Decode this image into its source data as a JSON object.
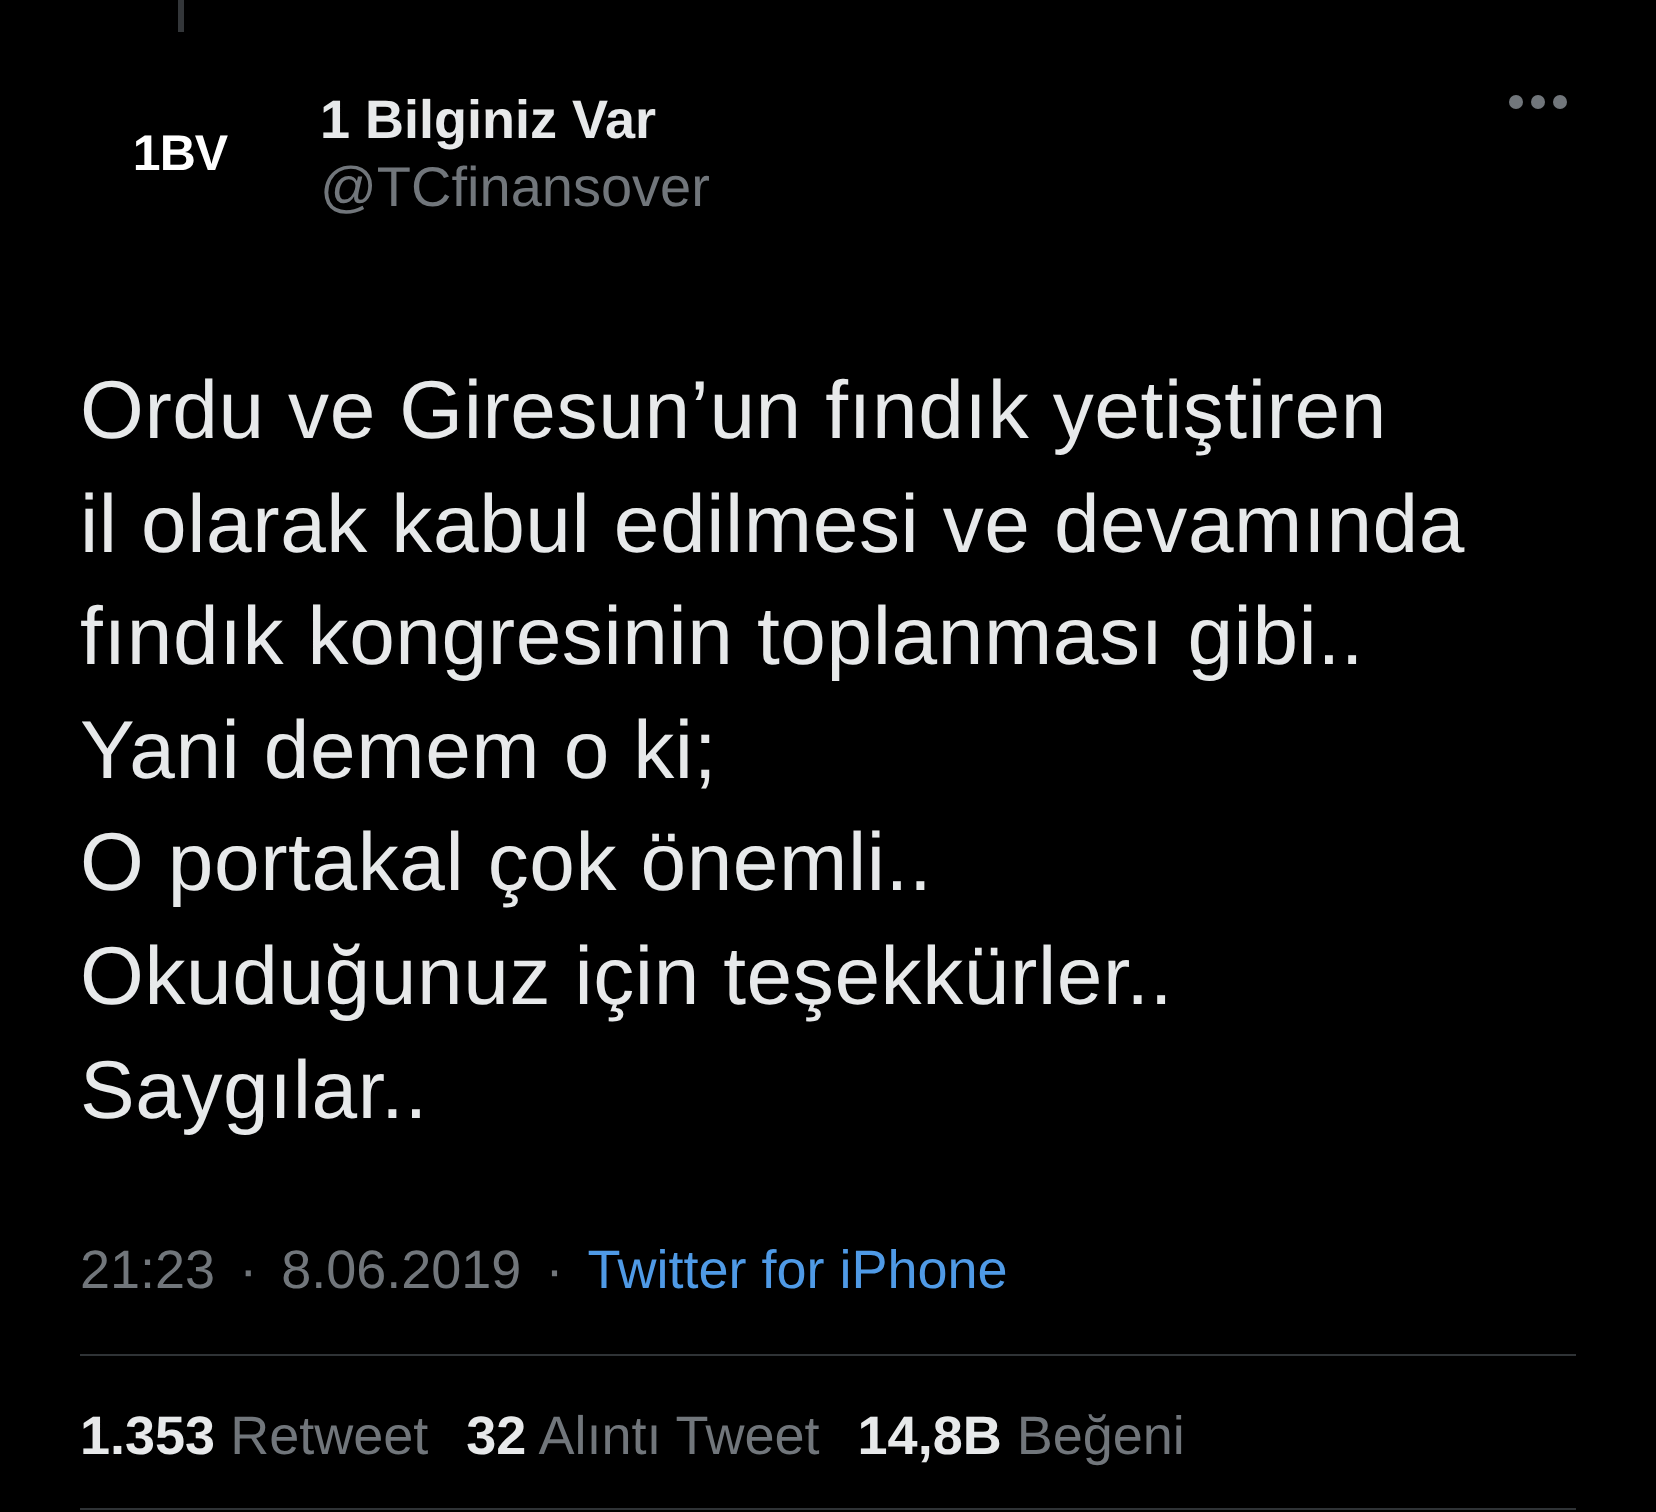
{
  "author": {
    "avatar_text": "1BV",
    "name": "1 Bilginiz Var",
    "handle": "@TCfinansover"
  },
  "tweet": {
    "text": "Ordu ve Giresun’un fındık yetiştiren\nil olarak kabul edilmesi ve devamında\nfındık kongresinin toplanması gibi..\nYani demem o ki;\nO portakal çok önemli..\nOkuduğunuz için teşekkürler..\nSaygılar.."
  },
  "meta": [
    {
      "kind": "time",
      "text": "21:23"
    },
    {
      "kind": "separator",
      "text": "·"
    },
    {
      "kind": "date",
      "text": "8.06.2019"
    },
    {
      "kind": "separator",
      "text": "·"
    },
    {
      "kind": "link",
      "text": "Twitter for iPhone"
    }
  ],
  "stats": [
    {
      "count": "1.353",
      "label": "Retweet"
    },
    {
      "count": "32",
      "label": "Alıntı Tweet"
    },
    {
      "count": "14,8B",
      "label": "Beğeni"
    }
  ]
}
